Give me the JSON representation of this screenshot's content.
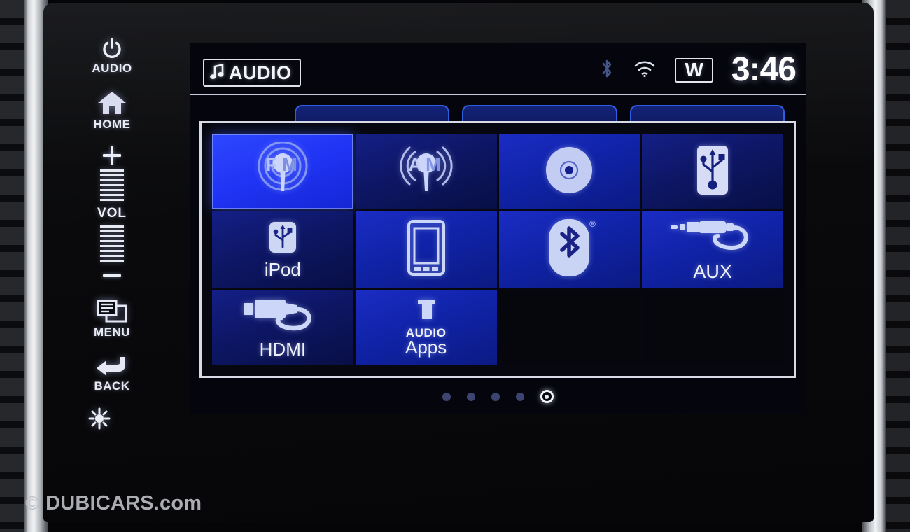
{
  "hardkeys": [
    {
      "name": "power-audio",
      "label": "AUDIO",
      "icon": "power-icon"
    },
    {
      "name": "home",
      "label": "HOME",
      "icon": "home-icon"
    },
    {
      "name": "volume",
      "label": "VOL",
      "plus": "+",
      "minus": "-",
      "icon": "volume-rocker-icon"
    },
    {
      "name": "menu",
      "label": "MENU",
      "icon": "menu-icon"
    },
    {
      "name": "back",
      "label": "BACK",
      "icon": "back-arrow-icon"
    },
    {
      "name": "day-night",
      "label": "",
      "icon": "sun-moon-icon"
    }
  ],
  "statusbar": {
    "mode_badge": "AUDIO",
    "mode_icon": "music-note-icon",
    "bluetooth_icon": "bluetooth-icon",
    "wifi_icon": "wifi-icon",
    "w_badge": "W",
    "clock": "3:46"
  },
  "background_tabs": [
    {
      "label": ""
    },
    {
      "label": ""
    },
    {
      "label": ""
    }
  ],
  "dialog": {
    "title": "",
    "sources": [
      {
        "label": "",
        "icon": "fm-radio-icon",
        "state": "selected",
        "row": 1
      },
      {
        "label": "",
        "icon": "am-radio-icon",
        "state": "dim",
        "row": 1
      },
      {
        "label": "",
        "icon": "cd-disc-icon",
        "state": "normal",
        "row": 1
      },
      {
        "label": "",
        "icon": "usb-icon",
        "state": "dim",
        "row": 1
      },
      {
        "label": "iPod",
        "icon": "usb-ipod-icon",
        "state": "dim",
        "row": 2
      },
      {
        "label": "",
        "icon": "smartphone-icon",
        "state": "normal",
        "row": 2
      },
      {
        "label": "",
        "icon": "bluetooth-icon",
        "state": "normal",
        "row": 2
      },
      {
        "label": "AUX",
        "icon": "aux-cable-icon",
        "state": "normal",
        "row": 2
      },
      {
        "label": "HDMI",
        "icon": "hdmi-cable-icon",
        "state": "dim",
        "row": 3
      },
      {
        "label": "Apps",
        "label_top": "AUDIO",
        "icon": "audio-apps-icon",
        "state": "normal",
        "row": 3
      },
      {
        "label": "",
        "icon": "",
        "state": "empty",
        "row": 3
      },
      {
        "label": "",
        "icon": "",
        "state": "empty",
        "row": 3
      }
    ]
  },
  "pagination": {
    "total": 5,
    "active_index": 5
  },
  "watermark": {
    "copyright": "©",
    "text": "DUBICARS.com"
  },
  "colors": {
    "tile_selected": "#2f47ff",
    "tile_normal": "#1b2cc4",
    "tile_dim": "#141f86",
    "screen_bg": "#05060d",
    "border_white": "#d8dbe6",
    "tab_border": "#2f5de0"
  }
}
